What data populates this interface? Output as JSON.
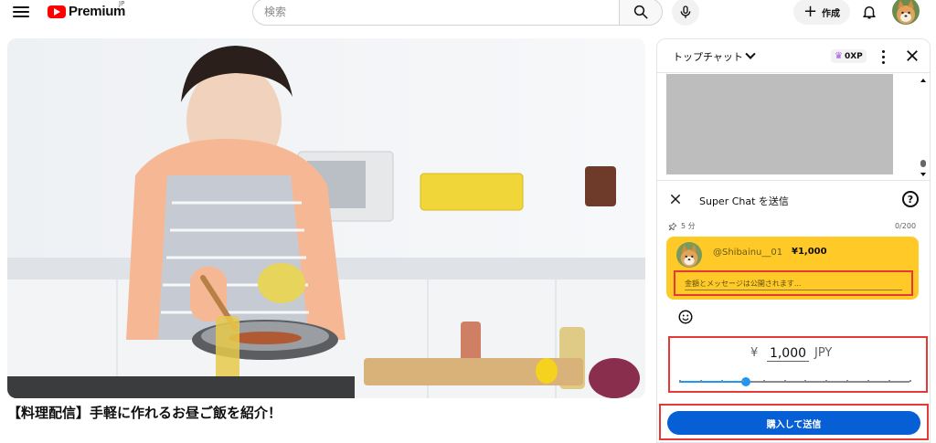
{
  "header": {
    "logo_text": "Premium",
    "logo_region": "JP",
    "search_placeholder": "検索",
    "create_label": "作成"
  },
  "icons": {
    "menu": "menu-icon",
    "search": "search-icon",
    "mic": "mic-icon",
    "bell": "bell-icon",
    "close": "close-icon",
    "help": "help-icon",
    "pin": "pin-icon",
    "emoji": "emoji-icon"
  },
  "video": {
    "title": "【料理配信】手軽に作れるお昼ご飯を紹介！"
  },
  "chat": {
    "title": "トップチャット",
    "xp_label": "0XP"
  },
  "superchat": {
    "title": "Super Chat を送信",
    "duration": "5 分",
    "char_count": "0/200",
    "username": "@Shibainu__01",
    "amount_label": "¥1,000",
    "message_placeholder": "金額とメッセージは公開されます...",
    "currency_symbol": "¥",
    "amount_value": "1,000",
    "currency_code": "JPY",
    "slider_level": 0.29,
    "buy_label": "購入して送信"
  },
  "colors": {
    "brand_red": "#ff0000",
    "superchat_yellow": "#ffca28",
    "primary_blue": "#065fd4",
    "slider_blue": "#2196f3",
    "highlight_red": "#e53935",
    "crown_purple": "#a256e8"
  }
}
